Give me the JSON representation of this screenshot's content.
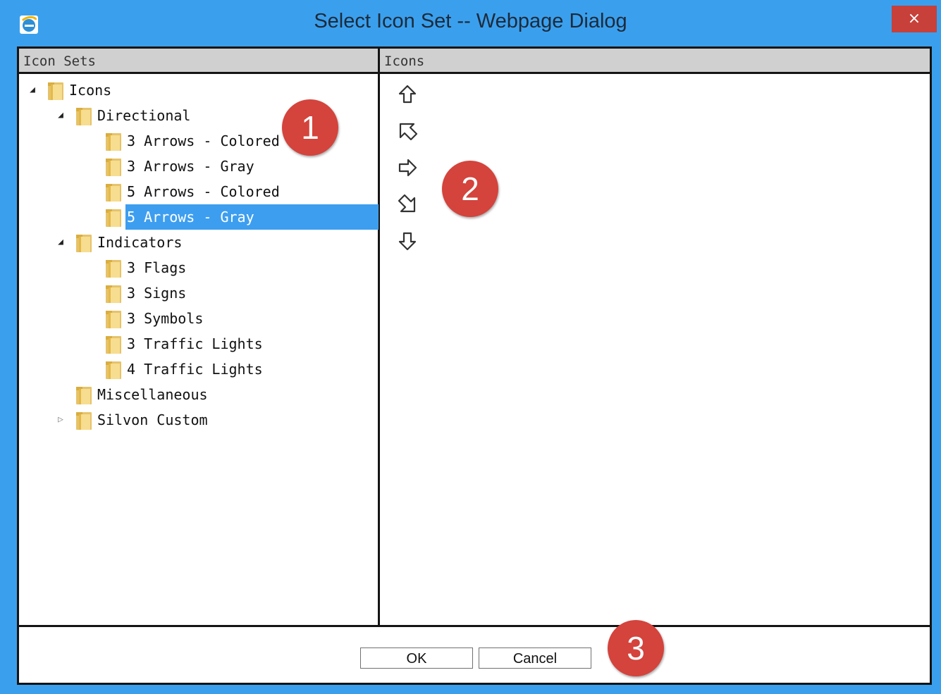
{
  "window": {
    "title": "Select Icon Set -- Webpage Dialog",
    "close_label": "×",
    "app_icon": "internet-explorer-icon",
    "accent_color": "#3aa0ee",
    "close_color": "#c8403a"
  },
  "left_pane": {
    "header": "Icon Sets",
    "tree": [
      {
        "label": "Icons",
        "level": 0,
        "toggle": "expanded"
      },
      {
        "label": "Directional",
        "level": 1,
        "toggle": "expanded"
      },
      {
        "label": "3 Arrows - Colored",
        "level": 2,
        "toggle": "none"
      },
      {
        "label": "3 Arrows - Gray",
        "level": 2,
        "toggle": "none"
      },
      {
        "label": "5 Arrows - Colored",
        "level": 2,
        "toggle": "none"
      },
      {
        "label": "5 Arrows - Gray",
        "level": 2,
        "toggle": "none",
        "selected": true
      },
      {
        "label": "Indicators",
        "level": 1,
        "toggle": "expanded"
      },
      {
        "label": "3 Flags",
        "level": 2,
        "toggle": "none"
      },
      {
        "label": "3 Signs",
        "level": 2,
        "toggle": "none"
      },
      {
        "label": "3 Symbols",
        "level": 2,
        "toggle": "none"
      },
      {
        "label": "3 Traffic Lights",
        "level": 2,
        "toggle": "none"
      },
      {
        "label": "4 Traffic Lights",
        "level": 2,
        "toggle": "none"
      },
      {
        "label": "Miscellaneous",
        "level": 1,
        "toggle": "none"
      },
      {
        "label": "Silvon Custom",
        "level": 1,
        "toggle": "collapsed"
      }
    ]
  },
  "right_pane": {
    "header": "Icons",
    "icons": [
      "arrow-up-icon",
      "arrow-up-right-icon",
      "arrow-right-icon",
      "arrow-down-right-icon",
      "arrow-down-icon"
    ]
  },
  "footer": {
    "ok_label": "OK",
    "cancel_label": "Cancel"
  },
  "callouts": [
    "1",
    "2",
    "3"
  ],
  "selection_color": "#3d9ef0"
}
